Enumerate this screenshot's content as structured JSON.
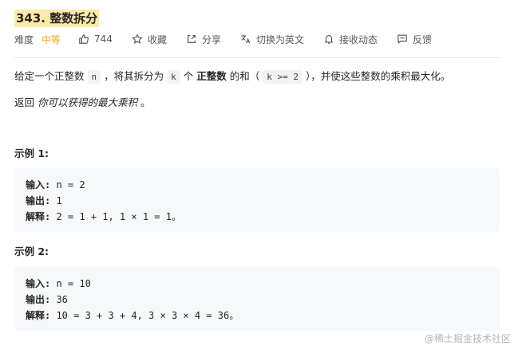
{
  "problem": {
    "title": "343. 整数拆分",
    "difficulty_label": "难度",
    "difficulty": "中等",
    "likes": "744",
    "favorite": "收藏",
    "share": "分享",
    "translate": "切换为英文",
    "notify": "接收动态",
    "feedback": "反馈"
  },
  "description": {
    "p1_a": "给定一个正整数",
    "p1_n": "n",
    "p1_b": "，将其拆分为",
    "p1_k": "k",
    "p1_c": "个",
    "p1_bold": "正整数",
    "p1_d": "的和（",
    "p1_cond": "k >= 2",
    "p1_e": "），并使这些整数的乘积最大化。",
    "p2_a": "返回",
    "p2_italic": "你可以获得的最大乘积",
    "p2_b": "。"
  },
  "examples": [
    {
      "heading": "示例 1:",
      "input_label": "输入:",
      "input": " n = 2",
      "output_label": "输出:",
      "output": " 1",
      "explain_label": "解释:",
      "explain": " 2 = 1 + 1, 1 × 1 = 1。"
    },
    {
      "heading": "示例 2:",
      "input_label": "输入:",
      "input": " n = 10",
      "output_label": "输出:",
      "output": " 36",
      "explain_label": "解释:",
      "explain": " 10 = 3 + 3 + 4, 3 × 3 × 4 = 36。"
    }
  ],
  "watermark": "@稀土掘金技术社区"
}
